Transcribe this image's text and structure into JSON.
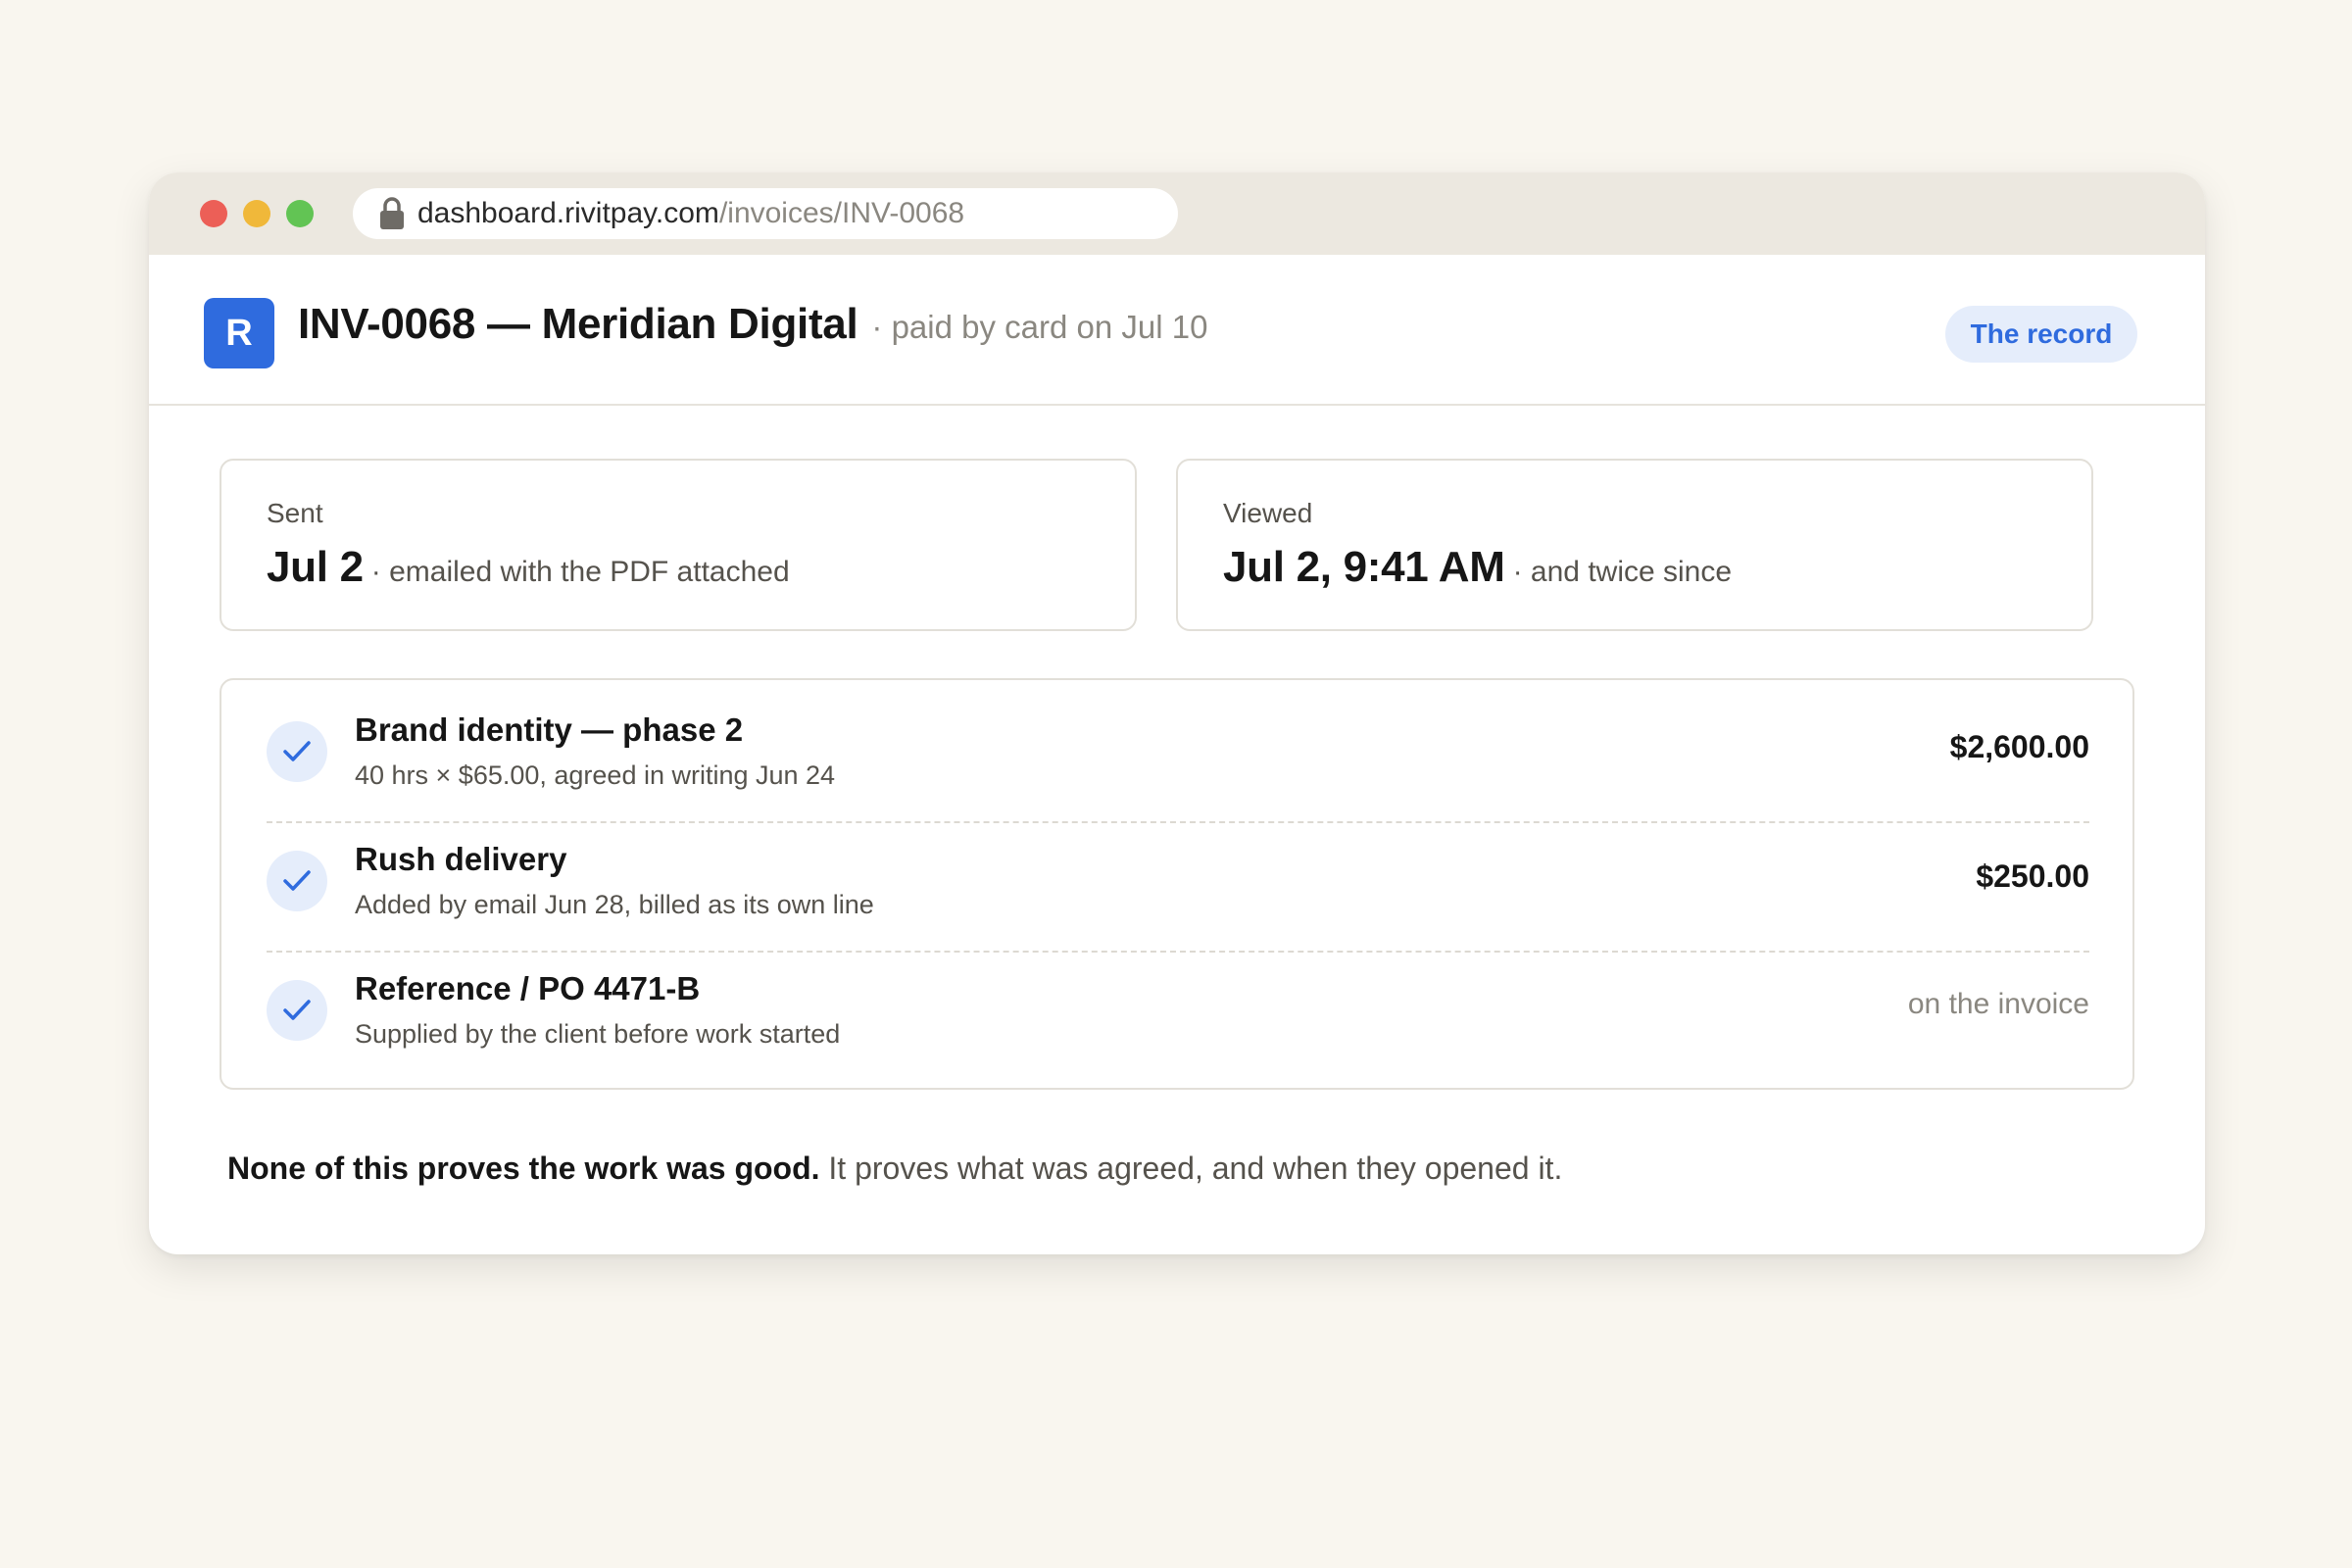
{
  "browser": {
    "url_host": "dashboard.rivitpay.com",
    "url_path": "/invoices/INV-0068"
  },
  "header": {
    "logo_letter": "R",
    "title": "INV-0068 — Meridian Digital",
    "subtitle": "· paid by card on Jul 10",
    "record_button": "The record"
  },
  "cards": {
    "sent": {
      "label": "Sent",
      "value": "Jul 2",
      "detail": "· emailed with the PDF attached"
    },
    "viewed": {
      "label": "Viewed",
      "value": "Jul 2, 9:41 AM",
      "detail": "· and twice since"
    }
  },
  "items": [
    {
      "title": "Brand identity — phase 2",
      "subtitle": "40 hrs × $65.00, agreed in writing Jun 24",
      "amount": "$2,600.00"
    },
    {
      "title": "Rush delivery",
      "subtitle": "Added by email Jun 28, billed as its own line",
      "amount": "$250.00"
    },
    {
      "title": "Reference / PO 4471-B",
      "subtitle": "Supplied by the client before work started",
      "amount": "on the invoice"
    }
  ],
  "footnote": {
    "strong": "None of this proves the work was good.",
    "rest": " It proves what was agreed, and when they opened it."
  },
  "colors": {
    "accent": "#2f6bde",
    "accent_soft": "#e5edfb",
    "background": "#f9f6ef"
  }
}
